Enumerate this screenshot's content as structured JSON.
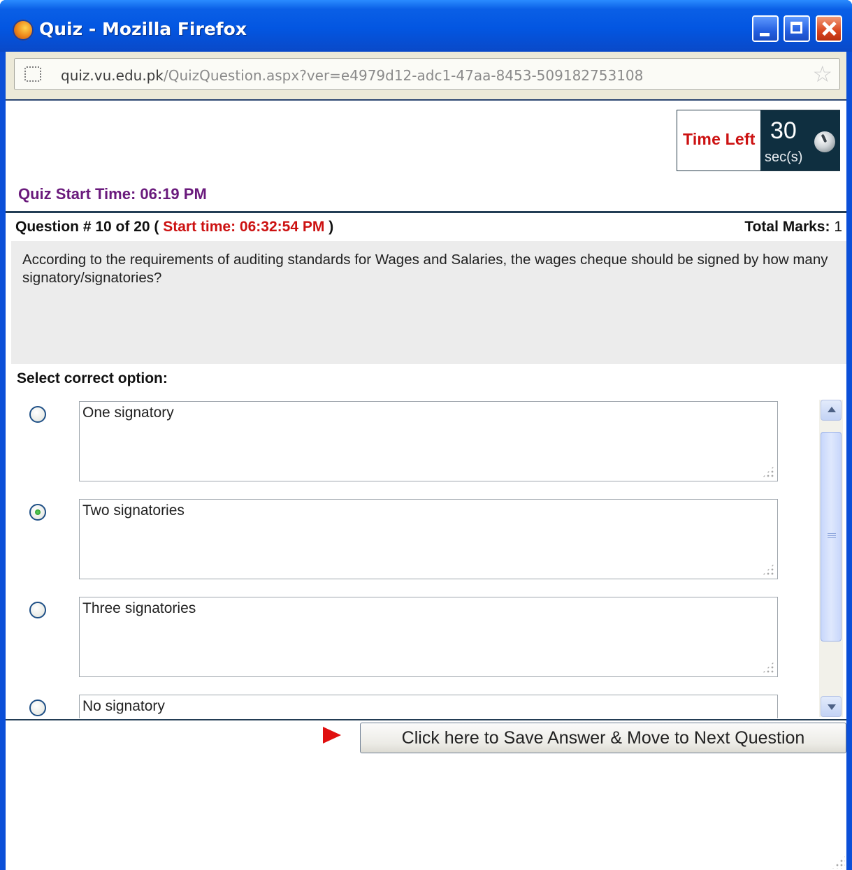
{
  "window": {
    "title": "Quiz - Mozilla Firefox"
  },
  "address_bar": {
    "url_host": "quiz.vu.edu.pk",
    "url_path": "/QuizQuestion.aspx?ver=e4979d12-adc1-47aa-8453-509182753108"
  },
  "timer": {
    "label": "Time Left",
    "value": "30",
    "unit": "sec(s)"
  },
  "quiz": {
    "start_time_text": "Quiz Start Time: 06:19 PM",
    "question_prefix": "Question # 10 of 20",
    "open_paren": "(",
    "start_time_label": "Start time: 06:32:54 PM",
    "close_paren": ")",
    "total_marks_label": "Total Marks:",
    "total_marks_value": "1",
    "question_text": "According to the requirements of auditing standards for Wages and Salaries, the wages cheque should be signed by how many signatory/signatories?",
    "select_label": "Select correct option:",
    "options": [
      {
        "text": "One signatory",
        "selected": false
      },
      {
        "text": "Two signatories",
        "selected": true
      },
      {
        "text": "Three signatories",
        "selected": false
      },
      {
        "text": "No signatory",
        "selected": false
      }
    ],
    "next_button": "Click here to Save Answer & Move to Next Question"
  }
}
